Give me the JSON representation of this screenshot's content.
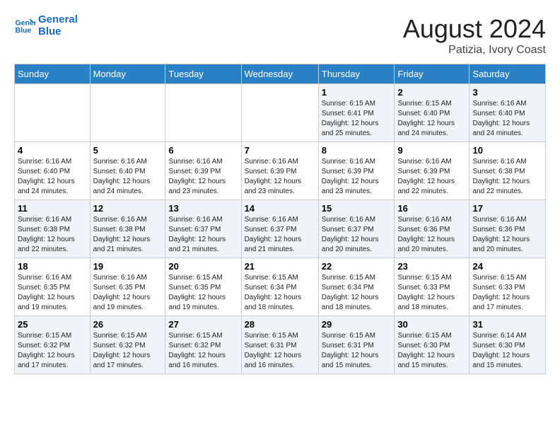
{
  "logo": {
    "line1": "General",
    "line2": "Blue"
  },
  "title": "August 2024",
  "subtitle": "Patizia, Ivory Coast",
  "days_of_week": [
    "Sunday",
    "Monday",
    "Tuesday",
    "Wednesday",
    "Thursday",
    "Friday",
    "Saturday"
  ],
  "weeks": [
    [
      {
        "day": "",
        "info": ""
      },
      {
        "day": "",
        "info": ""
      },
      {
        "day": "",
        "info": ""
      },
      {
        "day": "",
        "info": ""
      },
      {
        "day": "1",
        "info": "Sunrise: 6:15 AM\nSunset: 6:41 PM\nDaylight: 12 hours\nand 25 minutes."
      },
      {
        "day": "2",
        "info": "Sunrise: 6:15 AM\nSunset: 6:40 PM\nDaylight: 12 hours\nand 24 minutes."
      },
      {
        "day": "3",
        "info": "Sunrise: 6:16 AM\nSunset: 6:40 PM\nDaylight: 12 hours\nand 24 minutes."
      }
    ],
    [
      {
        "day": "4",
        "info": "Sunrise: 6:16 AM\nSunset: 6:40 PM\nDaylight: 12 hours\nand 24 minutes."
      },
      {
        "day": "5",
        "info": "Sunrise: 6:16 AM\nSunset: 6:40 PM\nDaylight: 12 hours\nand 24 minutes."
      },
      {
        "day": "6",
        "info": "Sunrise: 6:16 AM\nSunset: 6:39 PM\nDaylight: 12 hours\nand 23 minutes."
      },
      {
        "day": "7",
        "info": "Sunrise: 6:16 AM\nSunset: 6:39 PM\nDaylight: 12 hours\nand 23 minutes."
      },
      {
        "day": "8",
        "info": "Sunrise: 6:16 AM\nSunset: 6:39 PM\nDaylight: 12 hours\nand 23 minutes."
      },
      {
        "day": "9",
        "info": "Sunrise: 6:16 AM\nSunset: 6:39 PM\nDaylight: 12 hours\nand 22 minutes."
      },
      {
        "day": "10",
        "info": "Sunrise: 6:16 AM\nSunset: 6:38 PM\nDaylight: 12 hours\nand 22 minutes."
      }
    ],
    [
      {
        "day": "11",
        "info": "Sunrise: 6:16 AM\nSunset: 6:38 PM\nDaylight: 12 hours\nand 22 minutes."
      },
      {
        "day": "12",
        "info": "Sunrise: 6:16 AM\nSunset: 6:38 PM\nDaylight: 12 hours\nand 21 minutes."
      },
      {
        "day": "13",
        "info": "Sunrise: 6:16 AM\nSunset: 6:37 PM\nDaylight: 12 hours\nand 21 minutes."
      },
      {
        "day": "14",
        "info": "Sunrise: 6:16 AM\nSunset: 6:37 PM\nDaylight: 12 hours\nand 21 minutes."
      },
      {
        "day": "15",
        "info": "Sunrise: 6:16 AM\nSunset: 6:37 PM\nDaylight: 12 hours\nand 20 minutes."
      },
      {
        "day": "16",
        "info": "Sunrise: 6:16 AM\nSunset: 6:36 PM\nDaylight: 12 hours\nand 20 minutes."
      },
      {
        "day": "17",
        "info": "Sunrise: 6:16 AM\nSunset: 6:36 PM\nDaylight: 12 hours\nand 20 minutes."
      }
    ],
    [
      {
        "day": "18",
        "info": "Sunrise: 6:16 AM\nSunset: 6:35 PM\nDaylight: 12 hours\nand 19 minutes."
      },
      {
        "day": "19",
        "info": "Sunrise: 6:16 AM\nSunset: 6:35 PM\nDaylight: 12 hours\nand 19 minutes."
      },
      {
        "day": "20",
        "info": "Sunrise: 6:15 AM\nSunset: 6:35 PM\nDaylight: 12 hours\nand 19 minutes."
      },
      {
        "day": "21",
        "info": "Sunrise: 6:15 AM\nSunset: 6:34 PM\nDaylight: 12 hours\nand 18 minutes."
      },
      {
        "day": "22",
        "info": "Sunrise: 6:15 AM\nSunset: 6:34 PM\nDaylight: 12 hours\nand 18 minutes."
      },
      {
        "day": "23",
        "info": "Sunrise: 6:15 AM\nSunset: 6:33 PM\nDaylight: 12 hours\nand 18 minutes."
      },
      {
        "day": "24",
        "info": "Sunrise: 6:15 AM\nSunset: 6:33 PM\nDaylight: 12 hours\nand 17 minutes."
      }
    ],
    [
      {
        "day": "25",
        "info": "Sunrise: 6:15 AM\nSunset: 6:32 PM\nDaylight: 12 hours\nand 17 minutes."
      },
      {
        "day": "26",
        "info": "Sunrise: 6:15 AM\nSunset: 6:32 PM\nDaylight: 12 hours\nand 17 minutes."
      },
      {
        "day": "27",
        "info": "Sunrise: 6:15 AM\nSunset: 6:32 PM\nDaylight: 12 hours\nand 16 minutes."
      },
      {
        "day": "28",
        "info": "Sunrise: 6:15 AM\nSunset: 6:31 PM\nDaylight: 12 hours\nand 16 minutes."
      },
      {
        "day": "29",
        "info": "Sunrise: 6:15 AM\nSunset: 6:31 PM\nDaylight: 12 hours\nand 15 minutes."
      },
      {
        "day": "30",
        "info": "Sunrise: 6:15 AM\nSunset: 6:30 PM\nDaylight: 12 hours\nand 15 minutes."
      },
      {
        "day": "31",
        "info": "Sunrise: 6:14 AM\nSunset: 6:30 PM\nDaylight: 12 hours\nand 15 minutes."
      }
    ]
  ]
}
